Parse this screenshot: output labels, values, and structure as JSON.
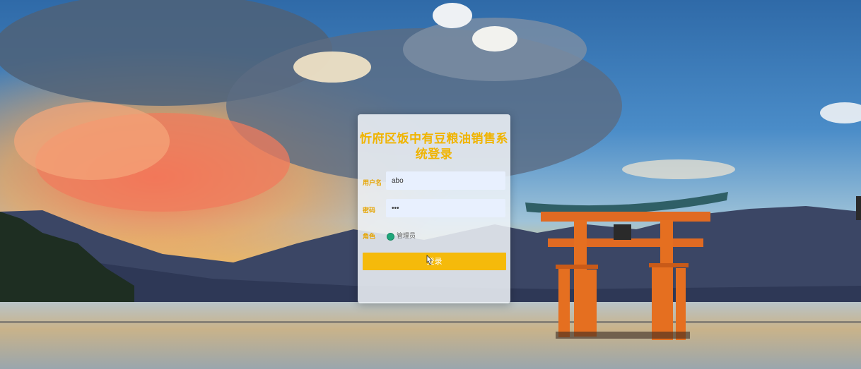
{
  "login": {
    "title": "忻府区饭中有豆粮油销售系统登录",
    "username_label": "用户名",
    "username_value": "abo",
    "password_label": "密码",
    "password_value": "•••",
    "role_label": "角色",
    "role_option": "管理员",
    "submit_label": "登录"
  },
  "colors": {
    "accent": "#F5BA0B",
    "title": "#F0B400",
    "radio": "#1FA67A"
  },
  "icons": [
    "cursor-icon"
  ]
}
